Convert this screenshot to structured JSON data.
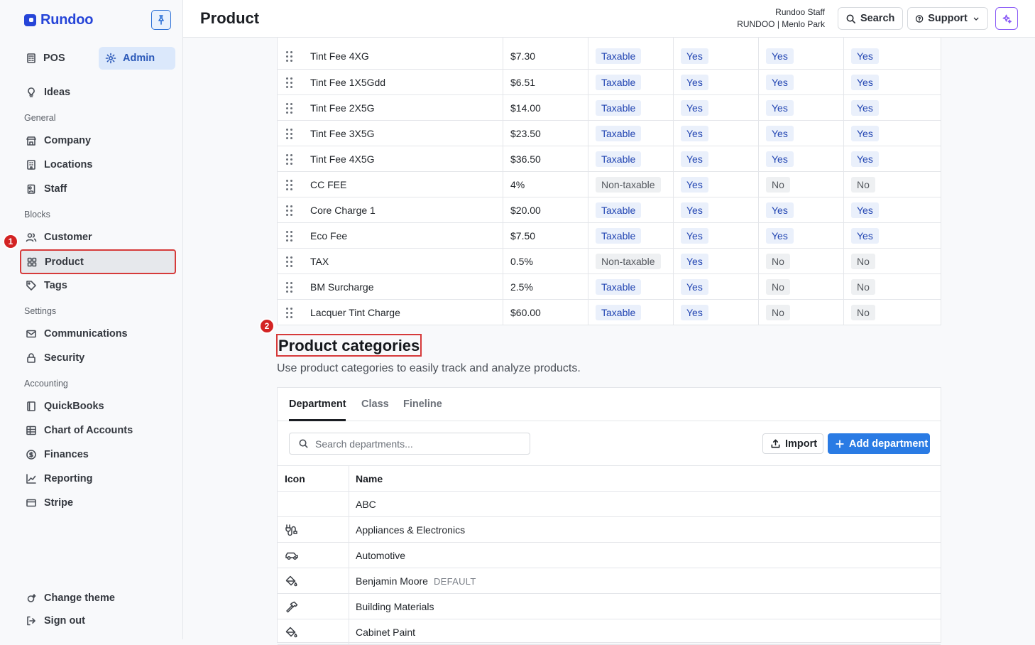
{
  "app": {
    "brand": "Rundoo"
  },
  "sidebar": {
    "modes": {
      "pos": "POS",
      "admin": "Admin"
    },
    "ideas": "Ideas",
    "sections": {
      "general": {
        "label": "General",
        "items": [
          "Company",
          "Locations",
          "Staff"
        ]
      },
      "blocks": {
        "label": "Blocks",
        "items": [
          "Customer",
          "Product",
          "Tags"
        ]
      },
      "settings": {
        "label": "Settings",
        "items": [
          "Communications",
          "Security"
        ]
      },
      "accounting": {
        "label": "Accounting",
        "items": [
          "QuickBooks",
          "Chart of Accounts",
          "Finances",
          "Reporting",
          "Stripe"
        ]
      }
    },
    "footer": {
      "theme": "Change theme",
      "signout": "Sign out"
    },
    "selected": "Product"
  },
  "annotations": {
    "one": "1",
    "two": "2"
  },
  "header": {
    "title": "Product",
    "user_name": "Rundoo Staff",
    "user_location": "RUNDOO | Menlo Park",
    "search": "Search",
    "support": "Support"
  },
  "fees": [
    {
      "name": "Tint Fee 4XG",
      "price": "$7.30",
      "tax": "Taxable",
      "c1": "Yes",
      "c2": "Yes",
      "c3": "Yes"
    },
    {
      "name": "Tint Fee 1X5Gdd",
      "price": "$6.51",
      "tax": "Taxable",
      "c1": "Yes",
      "c2": "Yes",
      "c3": "Yes"
    },
    {
      "name": "Tint Fee 2X5G",
      "price": "$14.00",
      "tax": "Taxable",
      "c1": "Yes",
      "c2": "Yes",
      "c3": "Yes"
    },
    {
      "name": "Tint Fee 3X5G",
      "price": "$23.50",
      "tax": "Taxable",
      "c1": "Yes",
      "c2": "Yes",
      "c3": "Yes"
    },
    {
      "name": "Tint Fee 4X5G",
      "price": "$36.50",
      "tax": "Taxable",
      "c1": "Yes",
      "c2": "Yes",
      "c3": "Yes"
    },
    {
      "name": "CC FEE",
      "price": "4%",
      "tax": "Non-taxable",
      "c1": "Yes",
      "c2": "No",
      "c3": "No"
    },
    {
      "name": "Core Charge 1",
      "price": "$20.00",
      "tax": "Taxable",
      "c1": "Yes",
      "c2": "Yes",
      "c3": "Yes"
    },
    {
      "name": "Eco Fee",
      "price": "$7.50",
      "tax": "Taxable",
      "c1": "Yes",
      "c2": "Yes",
      "c3": "Yes"
    },
    {
      "name": "TAX",
      "price": "0.5%",
      "tax": "Non-taxable",
      "c1": "Yes",
      "c2": "No",
      "c3": "No"
    },
    {
      "name": "BM Surcharge",
      "price": "2.5%",
      "tax": "Taxable",
      "c1": "Yes",
      "c2": "No",
      "c3": "No"
    },
    {
      "name": "Lacquer Tint Charge",
      "price": "$60.00",
      "tax": "Taxable",
      "c1": "Yes",
      "c2": "No",
      "c3": "No"
    }
  ],
  "categories": {
    "title": "Product categories",
    "subtitle": "Use product categories to easily track and analyze products.",
    "tabs": [
      "Department",
      "Class",
      "Fineline"
    ],
    "search_placeholder": "Search departments...",
    "import": "Import",
    "add": "Add department",
    "columns": {
      "icon": "Icon",
      "name": "Name"
    },
    "rows": [
      {
        "icon": "",
        "name": "ABC",
        "tag": ""
      },
      {
        "icon": "plug-icon",
        "name": "Appliances & Electronics",
        "tag": ""
      },
      {
        "icon": "car-icon",
        "name": "Automotive",
        "tag": ""
      },
      {
        "icon": "paint-bucket-icon",
        "name": "Benjamin Moore",
        "tag": "DEFAULT"
      },
      {
        "icon": "hammer-icon",
        "name": "Building Materials",
        "tag": ""
      },
      {
        "icon": "paint-bucket-icon",
        "name": "Cabinet Paint",
        "tag": ""
      }
    ]
  },
  "colors": {
    "accent": "#2a7be4",
    "highlight": "#d63a3a",
    "brand": "#2645d8",
    "ai": "#8b5cf6"
  }
}
